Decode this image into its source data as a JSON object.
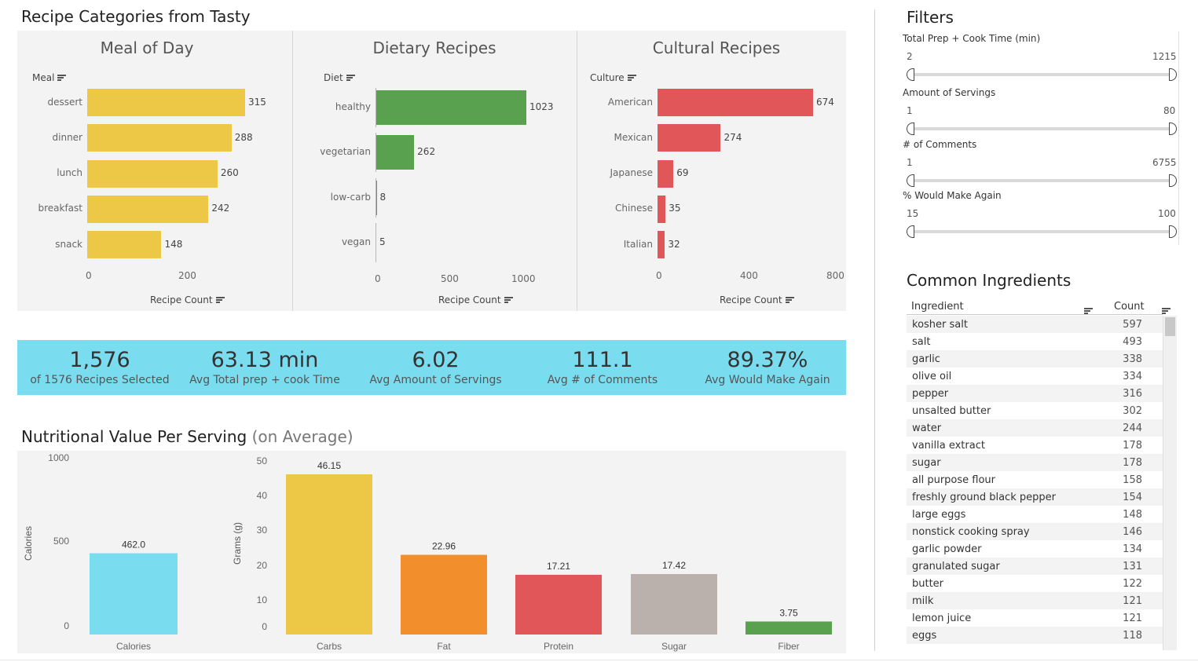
{
  "dashboard_title": "Recipe Categories from Tasty",
  "meal": {
    "title": "Meal of Day",
    "field": "Meal",
    "axis_title": "Recipe Count",
    "ticks": [
      "0",
      "200"
    ],
    "color": "#ECC846",
    "items": [
      {
        "label": "dessert",
        "value": "315"
      },
      {
        "label": "dinner",
        "value": "288"
      },
      {
        "label": "lunch",
        "value": "260"
      },
      {
        "label": "breakfast",
        "value": "242"
      },
      {
        "label": "snack",
        "value": "148"
      }
    ]
  },
  "diet": {
    "title": "Dietary Recipes",
    "field": "Diet",
    "axis_title": "Recipe Count",
    "ticks": [
      "0",
      "500",
      "1000"
    ],
    "color": "#59A14F",
    "items": [
      {
        "label": "healthy",
        "value": "1023"
      },
      {
        "label": "vegetarian",
        "value": "262"
      },
      {
        "label": "low-carb",
        "value": "8"
      },
      {
        "label": "vegan",
        "value": "5"
      }
    ]
  },
  "culture": {
    "title": "Cultural Recipes",
    "field": "Culture",
    "axis_title": "Recipe Count",
    "ticks": [
      "0",
      "400",
      "800"
    ],
    "color": "#E15759",
    "items": [
      {
        "label": "American",
        "value": "674"
      },
      {
        "label": "Mexican",
        "value": "274"
      },
      {
        "label": "Japanese",
        "value": "69"
      },
      {
        "label": "Chinese",
        "value": "35"
      },
      {
        "label": "Italian",
        "value": "32"
      }
    ]
  },
  "kpis": [
    {
      "value": "1,576",
      "label": "of 1576 Recipes Selected"
    },
    {
      "value": "63.13 min",
      "label": "Avg Total prep + cook Time"
    },
    {
      "value": "6.02",
      "label": "Avg Amount of Servings"
    },
    {
      "value": "111.1",
      "label": "Avg # of Comments"
    },
    {
      "value": "89.37%",
      "label": "Avg Would Make Again"
    }
  ],
  "kpi_bg": "#7ADCEF",
  "nutrition": {
    "title": "Nutritional Value Per Serving",
    "subtitle": "(on Average)",
    "cal_axis": "Calories",
    "cal_ticks": [
      "1000",
      "500",
      "0"
    ],
    "grams_axis": "Grams (g)",
    "grams_ticks": [
      "50",
      "40",
      "30",
      "20",
      "10",
      "0"
    ]
  },
  "chart_data": {
    "type": "bar",
    "title": "Nutritional Value Per Serving (on Average)",
    "calories": {
      "category": "Calories",
      "value": 462.0,
      "label": "462.0",
      "ylim": [
        0,
        1000
      ],
      "ylabel": "Calories",
      "color": "#7ADCEF"
    },
    "categories": [
      "Carbs",
      "Fat",
      "Protein",
      "Sugar",
      "Fiber"
    ],
    "values": [
      46.15,
      22.96,
      17.21,
      17.42,
      3.75
    ],
    "labels": [
      "46.15",
      "22.96",
      "17.21",
      "17.42",
      "3.75"
    ],
    "colors": [
      "#ECC846",
      "#F28E2B",
      "#E15759",
      "#BAB0AC",
      "#59A14F"
    ],
    "ylabel": "Grams (g)",
    "ylim": [
      0,
      50
    ]
  },
  "filters": {
    "title": "Filters",
    "items": [
      {
        "label": "Total Prep + Cook Time (min)",
        "min": "2",
        "max": "1215"
      },
      {
        "label": "Amount of Servings",
        "min": "1",
        "max": "80"
      },
      {
        "label": "# of Comments",
        "min": "1",
        "max": "6755"
      },
      {
        "label": "% Would Make Again",
        "min": "15",
        "max": "100"
      }
    ]
  },
  "ingredients": {
    "title": "Common Ingredients",
    "col_ingredient": "Ingredient",
    "col_count": "Count",
    "rows": [
      {
        "name": "kosher salt",
        "count": "597"
      },
      {
        "name": "salt",
        "count": "493"
      },
      {
        "name": "garlic",
        "count": "338"
      },
      {
        "name": "olive oil",
        "count": "334"
      },
      {
        "name": "pepper",
        "count": "316"
      },
      {
        "name": "unsalted butter",
        "count": "302"
      },
      {
        "name": "water",
        "count": "244"
      },
      {
        "name": "vanilla extract",
        "count": "178"
      },
      {
        "name": "sugar",
        "count": "178"
      },
      {
        "name": "all purpose flour",
        "count": "158"
      },
      {
        "name": "freshly ground black pepper",
        "count": "154"
      },
      {
        "name": "large eggs",
        "count": "148"
      },
      {
        "name": "nonstick cooking spray",
        "count": "146"
      },
      {
        "name": "garlic powder",
        "count": "134"
      },
      {
        "name": "granulated sugar",
        "count": "131"
      },
      {
        "name": "butter",
        "count": "122"
      },
      {
        "name": "milk",
        "count": "121"
      },
      {
        "name": "lemon juice",
        "count": "121"
      },
      {
        "name": "eggs",
        "count": "118"
      }
    ]
  }
}
